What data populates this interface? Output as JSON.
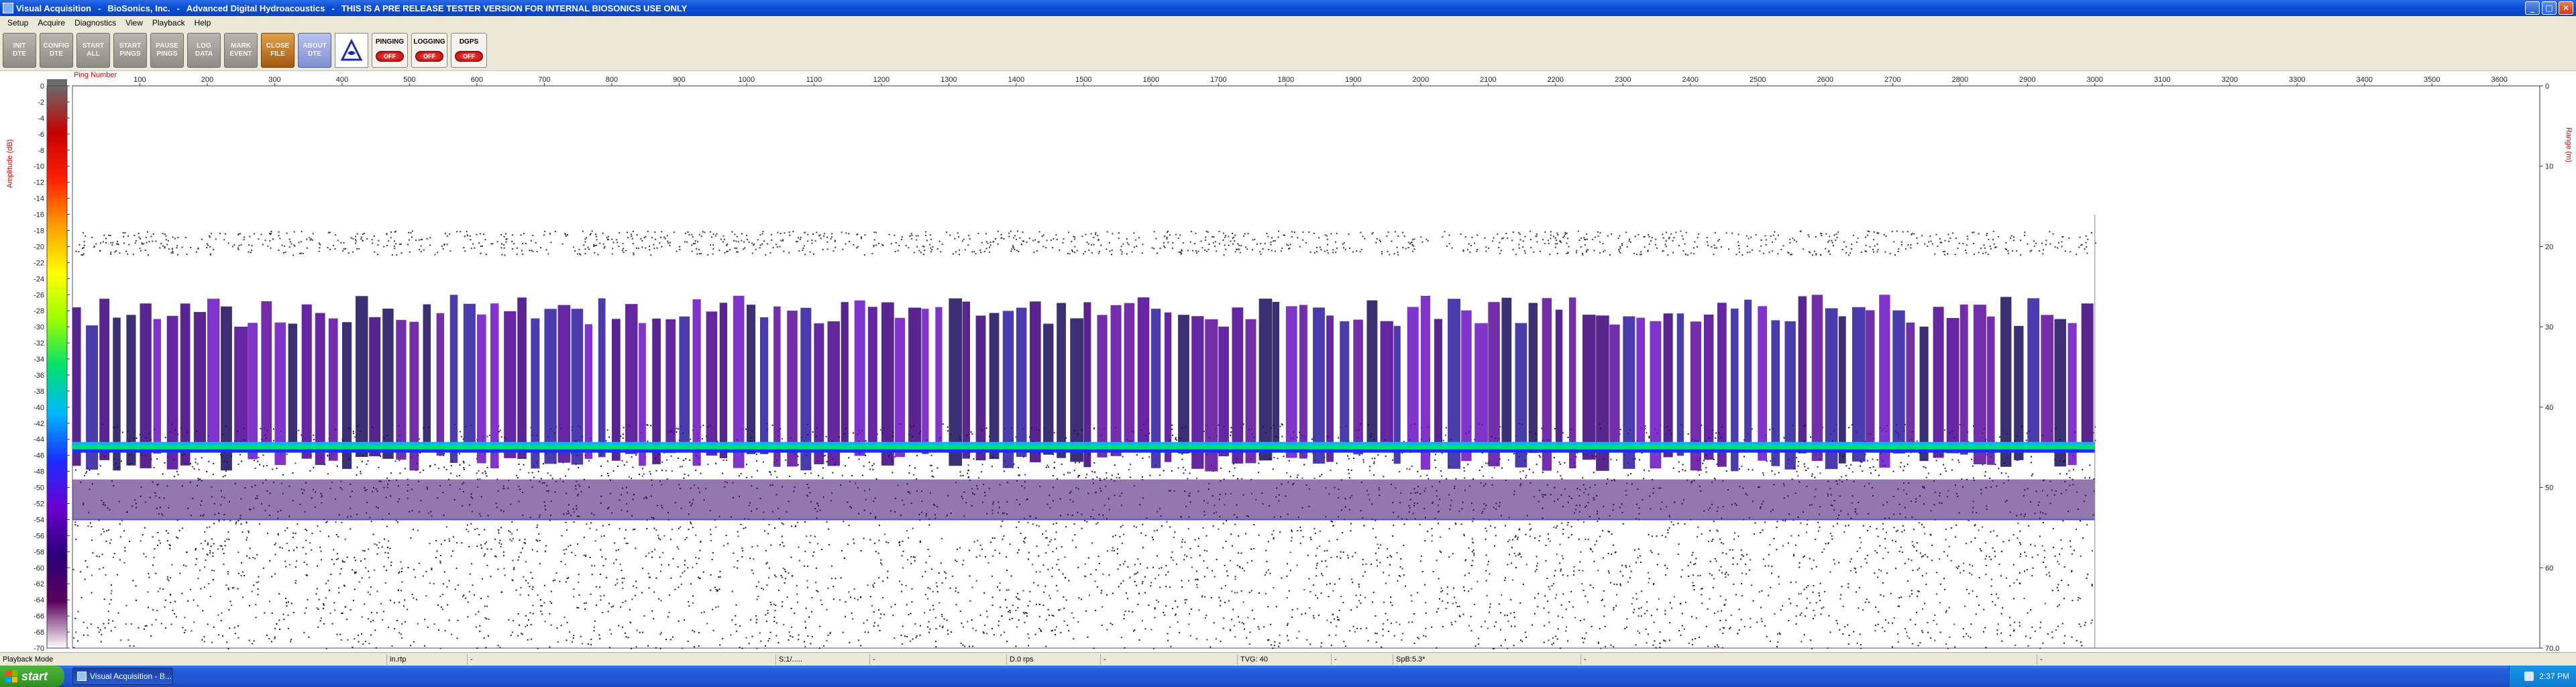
{
  "window": {
    "title_app": "Visual Acquisition",
    "title_company": "BioSonics, Inc.",
    "title_product": "Advanced Digital Hydroacoustics",
    "title_notice": "THIS IS A PRE RELEASE TESTER VERSION FOR INTERNAL BIOSONICS USE ONLY",
    "separator": "-",
    "buttons": {
      "minimize": "_",
      "maximize": "□",
      "close": "✕"
    }
  },
  "menu": [
    "Setup",
    "Acquire",
    "Diagnostics",
    "View",
    "Playback",
    "Help"
  ],
  "toolbar": {
    "buttons": [
      {
        "id": "init-dte",
        "label": "INIT\nDTE"
      },
      {
        "id": "config-dte",
        "label": "CONFIG\nDTE"
      },
      {
        "id": "start-all",
        "label": "START\nALL"
      },
      {
        "id": "start-pings",
        "label": "START\nPINGS"
      },
      {
        "id": "pause-pings",
        "label": "PAUSE\nPINGS"
      },
      {
        "id": "log-data",
        "label": "LOG\nDATA"
      },
      {
        "id": "mark-event",
        "label": "MARK\nEVENT"
      },
      {
        "id": "close-file",
        "label": "CLOSE\nFILE"
      },
      {
        "id": "about-dte",
        "label": "ABOUT\nDTE"
      }
    ],
    "logo_icon": "biosonics-logo-icon",
    "status": [
      {
        "id": "pinging",
        "label": "PINGING",
        "led": "OFF"
      },
      {
        "id": "logging",
        "label": "LOGGING",
        "led": "OFF"
      },
      {
        "id": "dgps",
        "label": "DGPS",
        "led": "OFF"
      }
    ]
  },
  "chart_data": {
    "type": "heatmap",
    "xlabel": "Ping Number",
    "x_ticks": [
      100,
      200,
      300,
      400,
      500,
      600,
      700,
      800,
      900,
      1000,
      1100,
      1200,
      1300,
      1400,
      1500,
      1600,
      1700,
      1800,
      1900,
      2000,
      2100,
      2200,
      2300,
      2400,
      2500,
      2600,
      2700,
      2800,
      2900,
      3000,
      3100,
      3200,
      3300,
      3400,
      3500,
      3600
    ],
    "xlim": [
      0,
      3660
    ],
    "pings_recorded": 3000,
    "color_scale_label": "Amplitude (dB)",
    "color_scale_ticks": [
      0,
      -2,
      -4,
      -6,
      -8,
      -10,
      -12,
      -14,
      -16,
      -18,
      -20,
      -22,
      -24,
      -26,
      -28,
      -30,
      -32,
      -34,
      -36,
      -38,
      -40,
      -42,
      -44,
      -46,
      -48,
      -50,
      -52,
      -54,
      -56,
      -58,
      -60,
      -62,
      -64,
      -66,
      -68,
      -70
    ],
    "color_scale_range": [
      0,
      -70
    ],
    "ylabel": "Range (m)",
    "y_ticks": [
      "0",
      "10",
      "20",
      "30",
      "40",
      "50",
      "60",
      "70.0"
    ],
    "ylim": [
      0,
      70
    ],
    "features": {
      "surface_noise_depth_m": 20,
      "water_column_start_m": 26,
      "water_column_end_m": 42,
      "bottom_line_depth_m": 45,
      "secondary_line_depth_m": 54
    },
    "colors": {
      "scale": [
        "#ffffff",
        "#5a005a",
        "#2a007a",
        "#6a00d0",
        "#1a2cff",
        "#00b8ff",
        "#00e070",
        "#9aff00",
        "#ffff00",
        "#ffa000",
        "#ff2000",
        "#c80000",
        "#6b6b6b"
      ],
      "plot_bg": "#ffffff",
      "axis_label": "#d40000"
    }
  },
  "statusbar": {
    "mode": "Playback Mode",
    "fields": [
      "in.rtp",
      "-",
      "S:1/.....",
      "-",
      "D.0 rps",
      "-",
      "TVG: 40",
      "-",
      "SpB:5.3*",
      "-",
      "-"
    ]
  },
  "taskbar": {
    "start": "start",
    "task": "Visual Acquisition - B...",
    "clock": "2:37 PM"
  }
}
